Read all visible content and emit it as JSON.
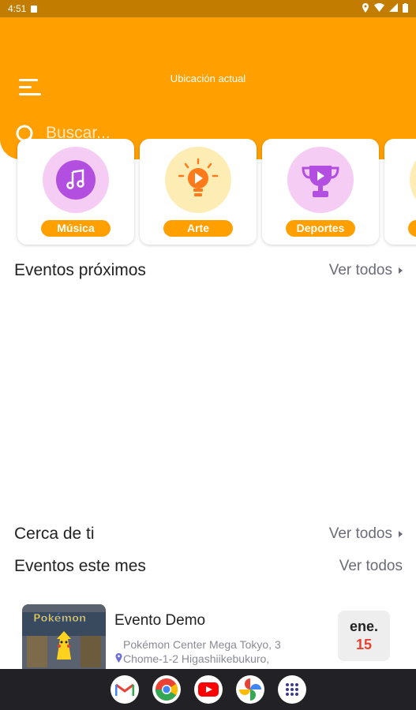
{
  "status_bar": {
    "time": "4:51"
  },
  "header": {
    "title": "Ubicación actual"
  },
  "search": {
    "placeholder": "Buscar..."
  },
  "categories": [
    {
      "label": "Música",
      "icon": "music-note-icon",
      "circle_color": "#f5ccf4",
      "inner_color": "#b24fe0"
    },
    {
      "label": "Arte",
      "icon": "lightbulb-play-icon",
      "circle_color": "#fdedb5",
      "inner_color": "#ff7a1a"
    },
    {
      "label": "Deportes",
      "icon": "trophy-icon",
      "circle_color": "#f5ccf4",
      "inner_color": "#b24fe0"
    },
    {
      "label": "",
      "icon": "partial-category-icon",
      "circle_color": "#fdedb5"
    }
  ],
  "sections": {
    "upcoming": {
      "title": "Eventos próximos",
      "see_all": "Ver todos"
    },
    "nearby": {
      "title": "Cerca de ti",
      "see_all": "Ver todos"
    },
    "this_month": {
      "title": "Eventos este mes",
      "see_all": "Ver todos"
    }
  },
  "event": {
    "title": "Evento Demo",
    "address_line1": "Pokémon Center Mega Tokyo, 3",
    "address_line2": "Chome-1-2 Higashiikebukuro,",
    "month": "ene.",
    "day": "15"
  },
  "dock": [
    {
      "name": "gmail-icon"
    },
    {
      "name": "chrome-icon"
    },
    {
      "name": "youtube-icon"
    },
    {
      "name": "photos-icon"
    },
    {
      "name": "app-drawer-icon"
    }
  ],
  "colors": {
    "accent": "#ff9f00",
    "status_bar": "#c27d00",
    "date_day": "#e8412f"
  }
}
